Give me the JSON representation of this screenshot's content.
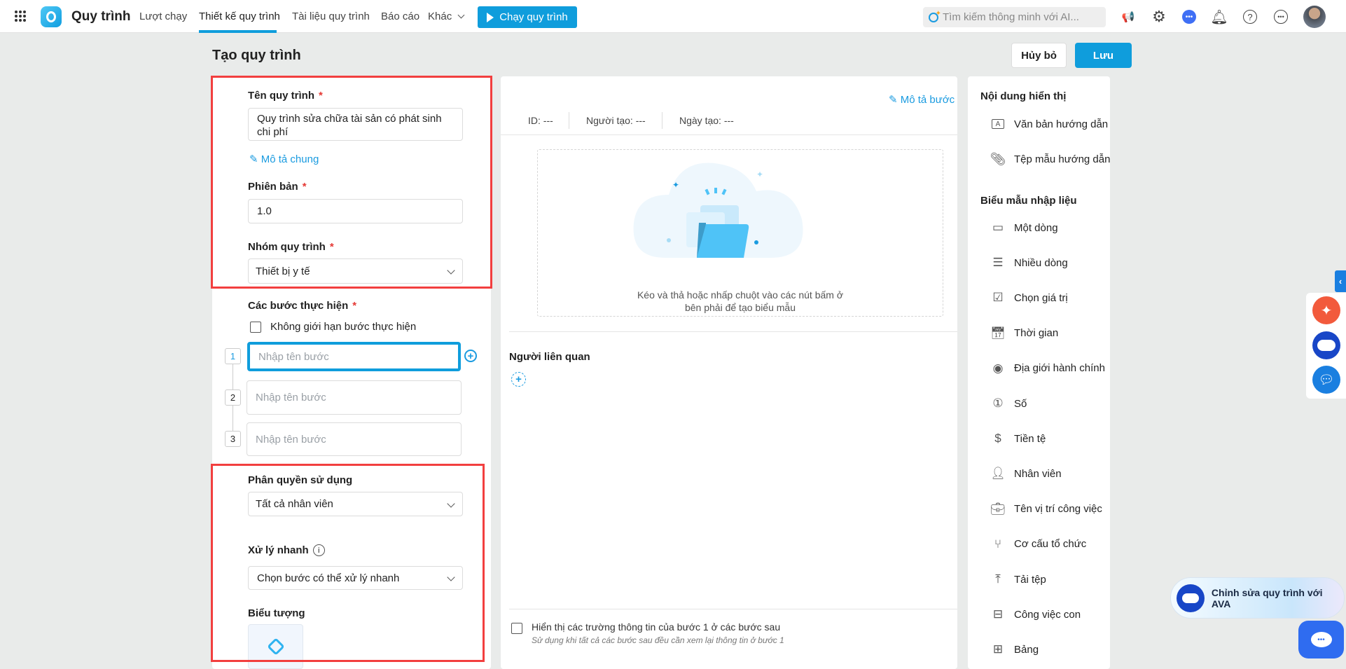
{
  "nav": {
    "app_name": "Quy trình",
    "links": [
      "Lượt chạy",
      "Thiết kế quy trình",
      "Tài liệu quy trình",
      "Báo cáo",
      "Khác"
    ],
    "active_link": "Thiết kế quy trình",
    "run_button": "Chạy quy trình",
    "search_placeholder": "Tìm kiếm thông minh với AI...",
    "accent": "#0f9ddc"
  },
  "page": {
    "title": "Tạo quy trình",
    "cancel": "Hủy bỏ",
    "save": "Lưu"
  },
  "form": {
    "name_label": "Tên quy trình",
    "name_value": "Quy trình sửa chữa tài sản có phát sinh chi phí",
    "general_desc": "Mô tả chung",
    "version_label": "Phiên bản",
    "version_value": "1.0",
    "group_label": "Nhóm quy trình",
    "group_value": "Thiết bị y tế",
    "steps_label": "Các bước thực hiện",
    "unlimited_steps": "Không giới hạn bước thực hiện",
    "steps": [
      {
        "num": "1",
        "placeholder": "Nhập tên bước"
      },
      {
        "num": "2",
        "placeholder": "Nhập tên bước"
      },
      {
        "num": "3",
        "placeholder": "Nhập tên bước"
      }
    ],
    "permission_label": "Phân quyền sử dụng",
    "permission_value": "Tất cả nhân viên",
    "quick_label": "Xử lý nhanh",
    "quick_placeholder": "Chọn bước có thể xử lý nhanh",
    "icon_label": "Biểu tượng",
    "required_mark": "*"
  },
  "middle": {
    "step_desc": "Mô tả bước",
    "id": "ID: ---",
    "creator": "Người tạo: ---",
    "created_date": "Ngày tạo: ---",
    "empty_text_1": "Kéo và thả hoặc nhấp chuột vào các nút bấm ở",
    "empty_text_2": "bên phải để tạo biểu mẫu",
    "related_label": "Người liên quan",
    "show_fields": "Hiển thị các trường thông tin của bước 1 ở các bước sau",
    "show_fields_hint": "Sử dụng khi tất cả các bước sau đều cần xem lại thông tin ở bước 1"
  },
  "right": {
    "display_header": "Nội dung hiển thị",
    "display_items": [
      "Văn bản hướng dẫn",
      "Tệp mẫu hướng dẫn"
    ],
    "form_header": "Biểu mẫu nhập liệu",
    "form_items": [
      "Một dòng",
      "Nhiều dòng",
      "Chọn giá trị",
      "Thời gian",
      "Địa giới hành chính",
      "Số",
      "Tiền tệ",
      "Nhân viên",
      "Tên vị trí công việc",
      "Cơ cấu tổ chức",
      "Tải tệp",
      "Công việc con",
      "Bảng"
    ]
  },
  "ava": {
    "label": "Chỉnh sửa quy trình với AVA"
  }
}
